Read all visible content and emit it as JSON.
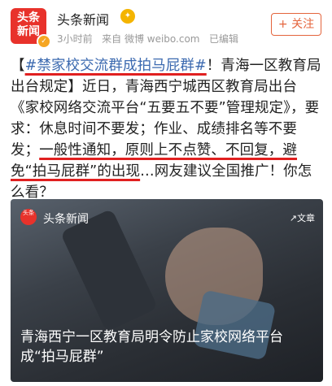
{
  "account": {
    "logo_text": "头条\n新闻",
    "name": "头条新闻",
    "medal": "V",
    "time": "3小时前",
    "source": "来自 微博 weibo.com",
    "edited": "已编辑",
    "follow_label": "+ 关注"
  },
  "post": {
    "bracket_open": "【",
    "hashtag": "#禁家校交流群成拍马屁群#",
    "part1": "！青海一区教育局出台规定】近日，青海西宁城西区教育局出台《家校网络交流平台“五要五不要”管理规定》，要求：休息时间不要发；作业、成绩排名等不要发；",
    "highlight": "一般性通知，原则上不点赞、不回复，避免“拍马屁群”的出现",
    "part2": "…网友建议全国推广！你怎么看？"
  },
  "card": {
    "logo_text": "头条",
    "source": "头条新闻",
    "tag": "文章",
    "title": "青海西宁一区教育局明令防止家校网络平台成“拍马屁群”"
  }
}
